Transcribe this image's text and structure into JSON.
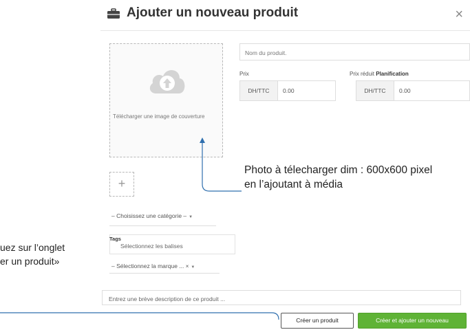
{
  "modal": {
    "title": "Ajouter un nouveau produit",
    "title_icon": "briefcase-icon",
    "close_label": "×"
  },
  "upload": {
    "icon": "cloud-upload-icon",
    "text": "Télécharger une image de couverture",
    "add_label": "+"
  },
  "form": {
    "name_placeholder": "Nom du produit.",
    "price_label": "Prix",
    "price_currency": "DH/TTC",
    "price_value": "0.00",
    "reduced_label": "Prix réduit",
    "planning_label": "Planification",
    "reduced_currency": "DH/TTC",
    "reduced_value": "0.00",
    "category_select": "– Choisissez une catégorie –",
    "tags_label": "Tags",
    "tags_placeholder": "Sélectionnez les balises",
    "brand_select": "– Sélectionnez la marque ...",
    "brand_clear": "×",
    "description_placeholder": "Entrez une brève description de ce produit ..."
  },
  "buttons": {
    "create": "Créer un produit",
    "create_and_new": "Créer et ajouter un nouveau"
  },
  "annotations": {
    "photo_line1": "Photo à télecharger dim : 600x600 pixel",
    "photo_line2": "en l’ajoutant à média",
    "side_line1": "uez sur l’onglet",
    "side_line2": "er un produit»"
  },
  "colors": {
    "primary_button": "#5fb336",
    "annotation_line": "#2f6fae"
  }
}
